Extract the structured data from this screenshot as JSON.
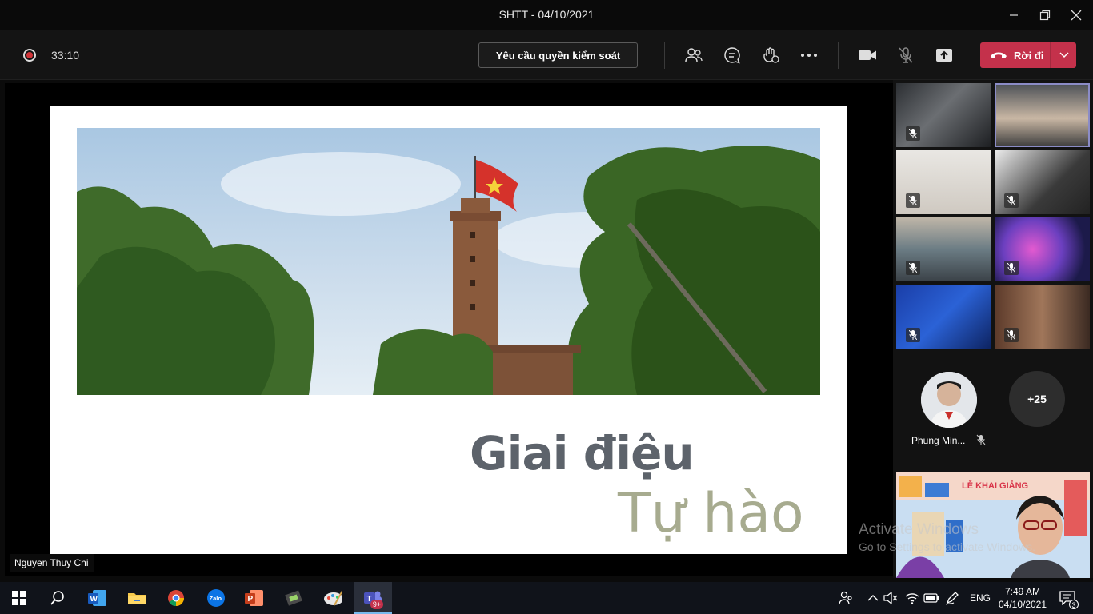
{
  "window": {
    "title": "SHTT - 04/10/2021"
  },
  "toolbar": {
    "timer": "33:10",
    "request_control_label": "Yêu cầu quyền kiểm soát",
    "leave_label": "Rời đi"
  },
  "slide": {
    "line1": "Giai điệu",
    "line2": "Tự hào"
  },
  "stage": {
    "presenter_name": "Nguyen Thuy Chi"
  },
  "participants": {
    "spotlight_name": "Phung Min...",
    "more_count": "+25",
    "teacher_banner": "LỄ KHAI GIẢNG"
  },
  "watermark": {
    "line1": "Activate Windows",
    "line2": "Go to Settings to activate Windows."
  },
  "taskbar": {
    "language": "ENG",
    "time": "7:49 AM",
    "date": "04/10/2021",
    "teams_badge": "9+",
    "notification_count": "3"
  },
  "colors": {
    "leave_red": "#c4314b",
    "selected_tile": "#8b8cc7",
    "headline_gray": "#5d636b",
    "headline_olive": "#a7ab8f"
  }
}
